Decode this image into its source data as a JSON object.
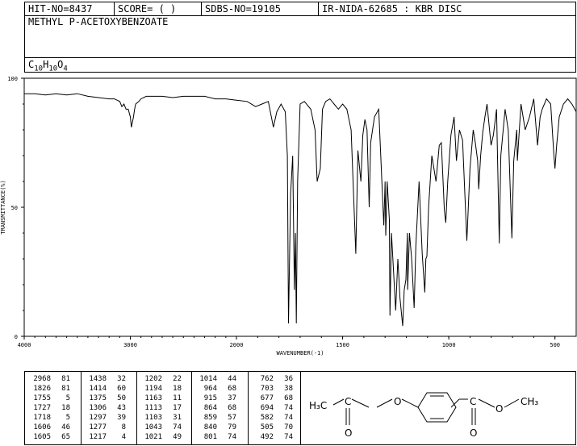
{
  "header": {
    "hit_no": "HIT-NO=8437",
    "score": "SCORE=  (   )",
    "sdbs_no": "SDBS-NO=19105",
    "ir_code": "IR-NIDA-62685 : KBR DISC",
    "compound_name": "METHYL P-ACETOXYBENZOATE",
    "formula": {
      "C": "C",
      "c": "10",
      "H": "H",
      "h": "10",
      "O": "O",
      "o": "4"
    }
  },
  "chart_data": {
    "type": "line",
    "xlabel": "WAVENUMBER(-1)",
    "ylabel": "TRANSMITTANCE(%)",
    "x_reversed": true,
    "xlim": [
      4000,
      400
    ],
    "ylim": [
      0,
      100
    ],
    "x_ticks": [
      4000,
      3000,
      2000,
      1500,
      1000,
      500
    ],
    "x_tick_labels": [
      "4000",
      "3000",
      "2000",
      "1500",
      "1000",
      "500"
    ],
    "y_ticks": [
      0,
      50,
      100
    ],
    "y_tick_labels": [
      "0",
      "50",
      "100"
    ],
    "series": [
      {
        "x": [
          4000,
          3900,
          3800,
          3700,
          3600,
          3500,
          3400,
          3300,
          3200,
          3150,
          3100,
          3080,
          3060,
          3040,
          3020,
          3000,
          2990,
          2970,
          2960,
          2950,
          2920,
          2900,
          2850,
          2800,
          2700,
          2600,
          2500,
          2400,
          2300,
          2200,
          2100,
          2000,
          1950,
          1910,
          1880,
          1850,
          1826,
          1810,
          1790,
          1770,
          1760,
          1755,
          1745,
          1735,
          1727,
          1722,
          1718,
          1712,
          1700,
          1680,
          1650,
          1630,
          1620,
          1605,
          1595,
          1580,
          1560,
          1540,
          1520,
          1500,
          1480,
          1460,
          1438,
          1428,
          1414,
          1405,
          1395,
          1385,
          1375,
          1368,
          1350,
          1330,
          1315,
          1306,
          1300,
          1297,
          1290,
          1280,
          1277,
          1270,
          1260,
          1250,
          1240,
          1230,
          1217,
          1210,
          1202,
          1195,
          1194,
          1185,
          1175,
          1163,
          1155,
          1140,
          1125,
          1113,
          1108,
          1103,
          1095,
          1080,
          1060,
          1045,
          1035,
          1021,
          1014,
          1005,
          990,
          975,
          964,
          950,
          935,
          915,
          900,
          885,
          875,
          864,
          859,
          850,
          840,
          830,
          820,
          801,
          790,
          775,
          762,
          755,
          735,
          720,
          703,
          694,
          680,
          677,
          660,
          640,
          620,
          600,
          582,
          570,
          560,
          540,
          520,
          505,
          500,
          492,
          480,
          460,
          440,
          420,
          400
        ],
        "y": [
          94,
          94,
          93.5,
          94,
          93.5,
          94,
          93,
          92.5,
          92,
          92,
          91,
          89,
          90,
          88,
          88,
          85,
          81,
          85,
          88,
          90,
          91,
          92,
          93,
          93,
          93,
          92.5,
          93,
          93,
          93,
          92,
          92,
          91.5,
          91,
          89,
          90,
          91,
          81,
          87,
          90,
          87,
          70,
          5,
          55,
          70,
          18,
          40,
          5,
          60,
          90,
          91,
          88,
          80,
          60,
          65,
          88,
          91,
          92,
          90,
          88,
          90,
          88,
          80,
          32,
          72,
          60,
          78,
          84,
          80,
          50,
          75,
          85,
          88,
          60,
          43,
          60,
          39,
          60,
          45,
          8,
          40,
          25,
          10,
          30,
          15,
          4,
          18,
          22,
          40,
          18,
          40,
          30,
          11,
          35,
          60,
          32,
          17,
          30,
          31,
          50,
          70,
          60,
          74,
          75,
          49,
          44,
          60,
          78,
          85,
          68,
          80,
          76,
          37,
          65,
          80,
          75,
          68,
          57,
          70,
          79,
          85,
          90,
          74,
          78,
          88,
          36,
          70,
          88,
          80,
          38,
          68,
          80,
          68,
          90,
          80,
          85,
          92,
          74,
          85,
          88,
          92,
          90,
          70,
          65,
          74,
          85,
          90,
          92,
          90,
          87
        ]
      }
    ]
  },
  "peaks": {
    "col1": [
      [
        "2968",
        "81"
      ],
      [
        "1826",
        "81"
      ],
      [
        "1755",
        "5"
      ],
      [
        "1727",
        "18"
      ],
      [
        "1718",
        "5"
      ],
      [
        "1606",
        "46"
      ],
      [
        "1605",
        "65"
      ]
    ],
    "col2": [
      [
        "1438",
        "32"
      ],
      [
        "1414",
        "60"
      ],
      [
        "1375",
        "50"
      ],
      [
        "1306",
        "43"
      ],
      [
        "1297",
        "39"
      ],
      [
        "1277",
        "8"
      ],
      [
        "1217",
        "4"
      ]
    ],
    "col3": [
      [
        "1202",
        "22"
      ],
      [
        "1194",
        "18"
      ],
      [
        "1163",
        "11"
      ],
      [
        "1113",
        "17"
      ],
      [
        "1103",
        "31"
      ],
      [
        "1043",
        "74"
      ],
      [
        "1021",
        "49"
      ]
    ],
    "col4": [
      [
        "1014",
        "44"
      ],
      [
        "964",
        "68"
      ],
      [
        "915",
        "37"
      ],
      [
        "864",
        "68"
      ],
      [
        "859",
        "57"
      ],
      [
        "840",
        "79"
      ],
      [
        "801",
        "74"
      ]
    ],
    "col5": [
      [
        "762",
        "36"
      ],
      [
        "703",
        "38"
      ],
      [
        "677",
        "68"
      ],
      [
        "694",
        "74"
      ],
      [
        "582",
        "74"
      ],
      [
        "505",
        "70"
      ],
      [
        "492",
        "74"
      ]
    ]
  },
  "structure": {
    "h3c": "H₃C",
    "ch3": "CH₃",
    "o_left": "O",
    "o_right": "O",
    "o_carbonyl_left": "O",
    "o_carbonyl_right": "O",
    "c_left": "C",
    "c_right": "C"
  }
}
